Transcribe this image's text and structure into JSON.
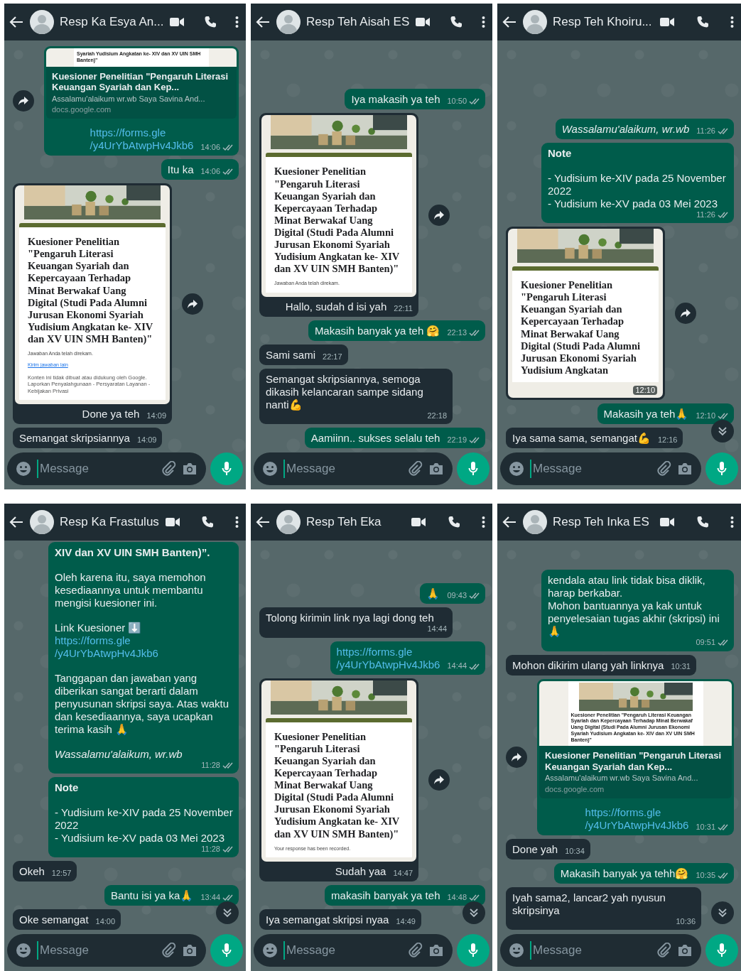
{
  "panels": [
    {
      "contact": "Resp Ka Esya An...",
      "placeholder": "Message",
      "scroll_button": false,
      "messages": [
        {
          "kind": "link",
          "outgoing": true,
          "forward": true,
          "thumb": {
            "banner": false,
            "text": "Syariah Yudisium Angkatan ke- XIV dan XV UIN SMH Banten)\""
          },
          "preview_title": "Kuesioner Penelitian \"Pengaruh Literasi Keuangan Syariah dan Kep...",
          "preview_desc": "Assalamu'alaikum wr.wb Saya Savina And...",
          "domain": "docs.google.com",
          "url_lines": [
            "https://forms.gle",
            "/y4UrYbAtwpHv4Jkb6"
          ],
          "time": "14:06",
          "read": false
        },
        {
          "kind": "text",
          "outgoing": true,
          "paragraphs": [
            {
              "kind": "plain",
              "text": "Itu ka"
            }
          ],
          "time": "14:06",
          "read": false
        },
        {
          "outgoing": false,
          "forward": true,
          "form": {
            "title": "Kuesioner Penelitian \"Pengaruh Literasi Keuangan Syariah dan Kepercayaan Terhadap Minat Berwakaf Uang Digital (Studi Pada Alumni Jurusan Ekonomi Syariah Yudisium Angkatan ke- XIV dan XV UIN SMH Banten)\"",
            "note": "Jawaban Anda telah direkam.",
            "link": "Kirim jawaban lain",
            "footer": "Konten ini tidak dibuat atau didukung oleh Google. Laporkan Penyalahgunaan - Persyaratan Layanan - Kebijakan Privasi"
          },
          "caption": "Done ya teh",
          "time": "14:09"
        },
        {
          "kind": "text",
          "outgoing": false,
          "paragraphs": [
            {
              "kind": "plain",
              "text": "Semangat skripsiannya"
            }
          ],
          "time": "14:09"
        }
      ]
    },
    {
      "contact": "Resp Teh Aisah ES",
      "placeholder": "Message",
      "scroll_button": false,
      "messages": [
        {
          "kind": "text",
          "outgoing": true,
          "paragraphs": [
            {
              "kind": "plain",
              "text": "Iya makasih ya teh"
            }
          ],
          "time": "10:50",
          "read": false
        },
        {
          "outgoing": false,
          "forward": true,
          "form": {
            "title": "Kuesioner Penelitian \"Pengaruh Literasi Keuangan Syariah dan Kepercayaan Terhadap Minat Berwakaf Uang Digital (Studi Pada Alumni Jurusan Ekonomi Syariah Yudisium Angkatan ke- XIV dan XV UIN SMH Banten)\"",
            "note": "Jawaban Anda telah direkam."
          },
          "caption": "Hallo, sudah d isi yah",
          "time": "22:11"
        },
        {
          "kind": "text",
          "outgoing": true,
          "paragraphs": [
            {
              "kind": "plain",
              "text": "Makasih banyak ya teh 🤗"
            }
          ],
          "time": "22:13",
          "read": false
        },
        {
          "kind": "text",
          "outgoing": false,
          "paragraphs": [
            {
              "kind": "plain",
              "text": "Sami sami"
            }
          ],
          "time": "22:17"
        },
        {
          "kind": "text",
          "outgoing": false,
          "paragraphs": [
            {
              "kind": "plain",
              "text": "Semangat skripsiannya, semoga dikasih kelancaran sampe sidang nanti💪"
            }
          ],
          "time": "22:18"
        },
        {
          "kind": "text",
          "outgoing": true,
          "paragraphs": [
            {
              "kind": "plain",
              "text": "Aamiinn.. sukses selalu teh"
            }
          ],
          "time": "22:19",
          "read": false
        }
      ]
    },
    {
      "contact": "Resp Teh Khoiru...",
      "placeholder": "Message",
      "scroll_button": true,
      "messages": [
        {
          "kind": "text",
          "outgoing": true,
          "paragraphs": [
            {
              "kind": "italic",
              "text": "Wassalamu'alaikum, wr.wb"
            }
          ],
          "time": "11:26",
          "read": false
        },
        {
          "kind": "text",
          "outgoing": true,
          "paragraphs": [
            {
              "kind": "bold",
              "text": "Note"
            },
            {
              "kind": "plain",
              "text": "- Yudisium ke-XIV pada 25 November 2022\n- Yudisium ke-XV pada 03 Mei 2023"
            }
          ],
          "time": "11:26",
          "read": false
        },
        {
          "outgoing": false,
          "forward": true,
          "form": {
            "title": "Kuesioner Penelitian \"Pengaruh Literasi Keuangan Syariah dan Kepercayaan Terhadap Minat Berwakaf Uang Digital (Studi Pada Alumni Jurusan Ekonomi Syariah Yudisium Angkatan"
          },
          "time": "12:10"
        },
        {
          "kind": "text",
          "outgoing": true,
          "paragraphs": [
            {
              "kind": "plain",
              "text": "Makasih ya teh🙏"
            }
          ],
          "time": "12:10",
          "read": false
        },
        {
          "kind": "text",
          "outgoing": false,
          "paragraphs": [
            {
              "kind": "plain",
              "text": "Iya sama sama, semangat💪"
            }
          ],
          "time": "12:16"
        }
      ]
    },
    {
      "contact": "Resp Ka Frastulus",
      "placeholder": "Message",
      "scroll_button": true,
      "messages": [
        {
          "kind": "text",
          "outgoing": true,
          "paragraphs": [
            {
              "kind": "bold",
              "text": "XIV dan XV UIN SMH Banten)”."
            },
            {
              "kind": "plain",
              "text": "Oleh karena itu, saya memohon kesediaannya untuk membantu mengisi kuesioner ini."
            },
            {
              "kind": "plain",
              "text": "Link Kuesioner ⬇️"
            },
            {
              "kind": "link",
              "lines": [
                "https://forms.gle",
                "/y4UrYbAtwpHv4Jkb6"
              ]
            },
            {
              "kind": "plain",
              "text": "Tanggapan dan jawaban yang diberikan sangat berarti dalam penyusunan skripsi saya. Atas waktu dan kesediaannya, saya ucapkan terima kasih 🙏"
            },
            {
              "kind": "italic",
              "text": "Wassalamu'alaikum, wr.wb"
            }
          ],
          "time": "11:28",
          "read": false
        },
        {
          "kind": "text",
          "outgoing": true,
          "paragraphs": [
            {
              "kind": "bold",
              "text": "Note"
            },
            {
              "kind": "plain",
              "text": "- Yudisium ke-XIV pada 25 November 2022\n- Yudisium ke-XV pada 03 Mei 2023"
            }
          ],
          "time": "11:28",
          "read": false
        },
        {
          "kind": "text",
          "outgoing": false,
          "paragraphs": [
            {
              "kind": "plain",
              "text": "Okeh"
            }
          ],
          "time": "12:57"
        },
        {
          "kind": "text",
          "outgoing": true,
          "paragraphs": [
            {
              "kind": "plain",
              "text": "Bantu isi ya ka🙏"
            }
          ],
          "time": "13:44",
          "read": false
        },
        {
          "kind": "text",
          "outgoing": false,
          "paragraphs": [
            {
              "kind": "plain",
              "text": "Oke semangat"
            }
          ],
          "time": "14:00"
        }
      ]
    },
    {
      "contact": "Resp Teh Eka",
      "placeholder": "Message",
      "scroll_button": true,
      "messages": [
        {
          "kind": "text",
          "outgoing": true,
          "paragraphs": [
            {
              "kind": "plain",
              "text": "🙏"
            }
          ],
          "time": "09:43",
          "read": false
        },
        {
          "kind": "text",
          "outgoing": false,
          "paragraphs": [
            {
              "kind": "plain",
              "text": "Tolong kirimin link nya lagi dong teh"
            }
          ],
          "time": "14:44"
        },
        {
          "kind": "text",
          "outgoing": true,
          "paragraphs": [
            {
              "kind": "link",
              "lines": [
                "https://forms.gle",
                "/y4UrYbAtwpHv4Jkb6"
              ]
            }
          ],
          "time": "14:44",
          "read": false
        },
        {
          "outgoing": false,
          "forward": true,
          "form": {
            "title": "Kuesioner Penelitian \"Pengaruh Literasi Keuangan Syariah dan Kepercayaan Terhadap Minat Berwakaf Uang Digital (Studi Pada Alumni Jurusan Ekonomi Syariah Yudisium Angkatan ke- XIV dan XV UIN SMH Banten)\"",
            "note": "Your response has been recorded."
          },
          "caption": "Sudah yaa",
          "time": "14:47"
        },
        {
          "kind": "text",
          "outgoing": true,
          "paragraphs": [
            {
              "kind": "plain",
              "text": "makasih banyak ya teh"
            }
          ],
          "time": "14:48",
          "read": false
        },
        {
          "kind": "text",
          "outgoing": false,
          "paragraphs": [
            {
              "kind": "plain",
              "text": "Iya semangat skripsi nyaa"
            }
          ],
          "time": "14:49"
        }
      ]
    },
    {
      "contact": "Resp Teh Inka ES",
      "placeholder": "Message",
      "scroll_button": true,
      "messages": [
        {
          "kind": "text",
          "outgoing": true,
          "paragraphs": [
            {
              "kind": "plain",
              "text": "kendala atau link tidak bisa diklik, harap berkabar.\nMohon bantuannya ya kak untuk penyelesaian tugas akhir (skripsi) ini\n🙏"
            }
          ],
          "time": "09:51",
          "read": false
        },
        {
          "kind": "text",
          "outgoing": false,
          "paragraphs": [
            {
              "kind": "plain",
              "text": "Mohon dikirim ulang yah linknya"
            }
          ],
          "time": "10:31"
        },
        {
          "kind": "link",
          "outgoing": true,
          "forward": true,
          "thumb": {
            "banner": true,
            "text": "Kuesioner Penelitian \"Pengaruh Literasi Keuangan Syariah dan Kepercayaan Terhadap Minat Berwakaf Uang Digital (Studi Pada Alumni Jurusan Ekonomi Syariah Yudisium Angkatan ke- XIV dan XV UIN SMH Banten)\""
          },
          "preview_title": "Kuesioner Penelitian \"Pengaruh Literasi Keuangan Syariah dan Kep...",
          "preview_desc": "Assalamu'alaikum wr.wb Saya Savina And...",
          "domain": "docs.google.com",
          "url_lines": [
            "https://forms.gle",
            "/y4UrYbAtwpHv4Jkb6"
          ],
          "time": "10:31",
          "read": false
        },
        {
          "kind": "text",
          "outgoing": false,
          "paragraphs": [
            {
              "kind": "plain",
              "text": "Done yah"
            }
          ],
          "time": "10:34"
        },
        {
          "kind": "text",
          "outgoing": true,
          "paragraphs": [
            {
              "kind": "plain",
              "text": "Makasih banyak ya tehh🤗"
            }
          ],
          "time": "10:35",
          "read": false
        },
        {
          "kind": "text",
          "outgoing": false,
          "paragraphs": [
            {
              "kind": "plain",
              "text": "Iyah sama2, lancar2 yah nyusun skripsinya"
            }
          ],
          "time": "10:36"
        }
      ]
    }
  ]
}
